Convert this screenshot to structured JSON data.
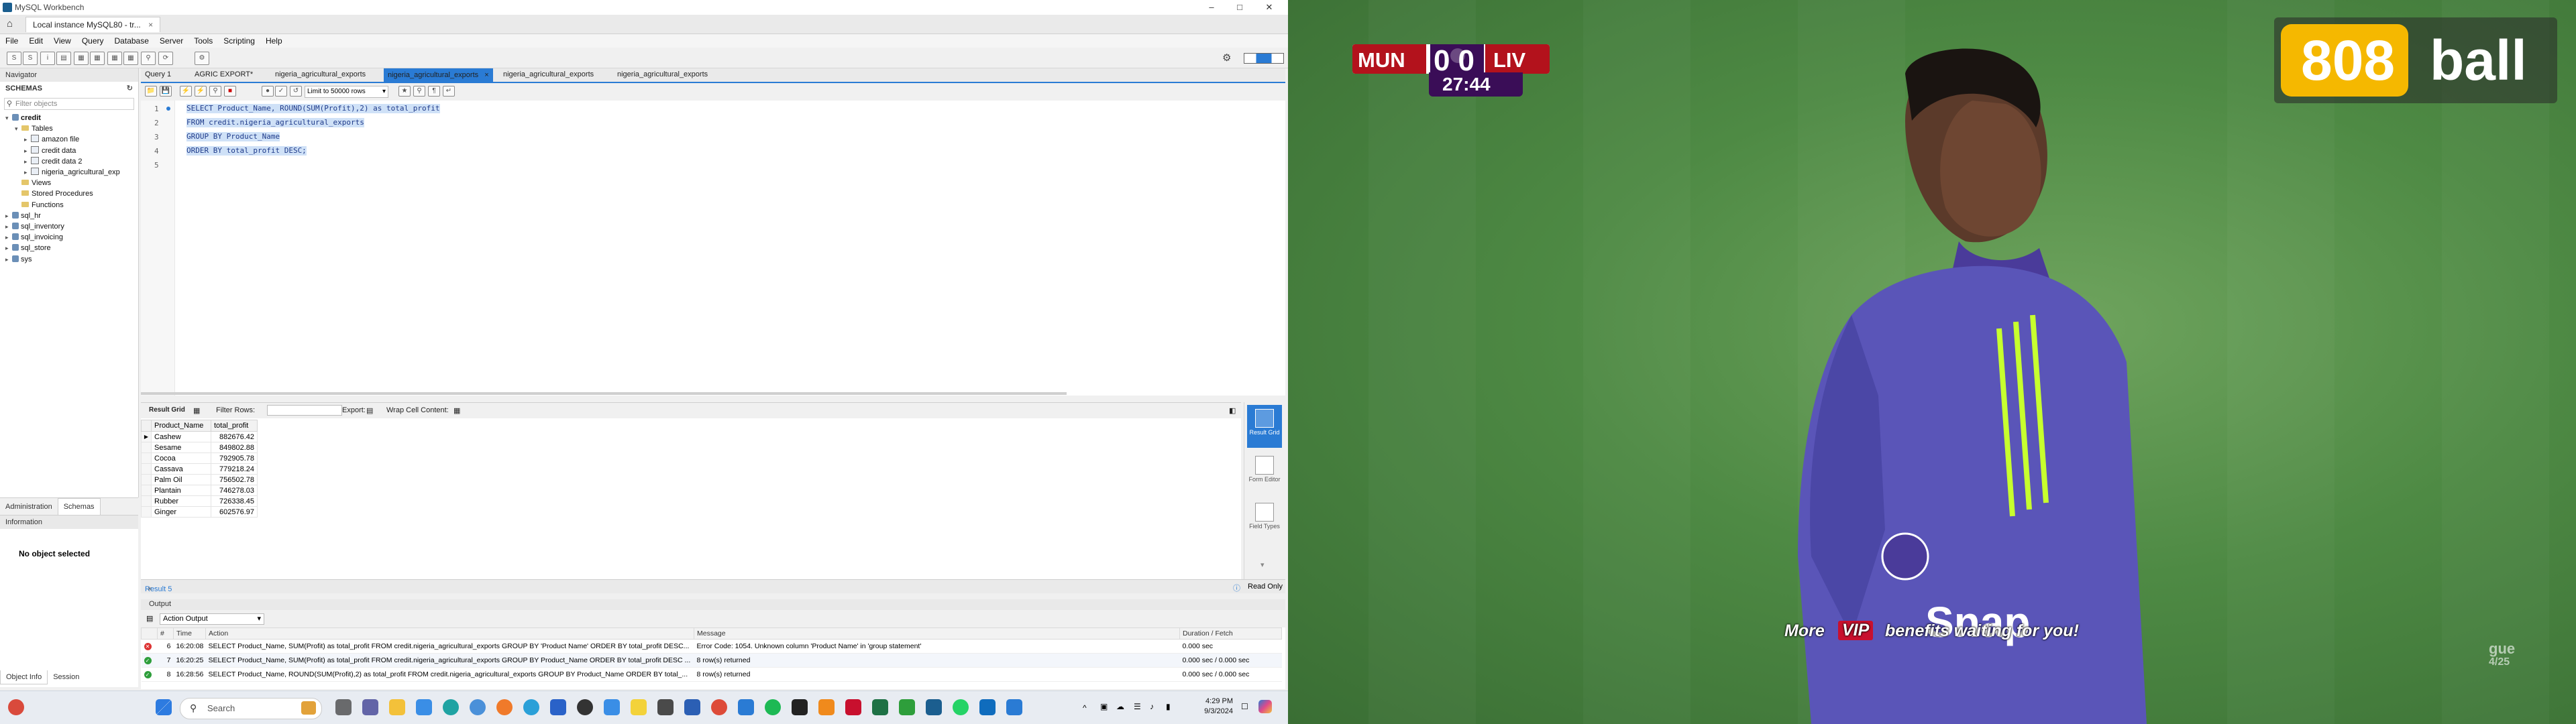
{
  "app": {
    "window_title": "MySQL Workbench",
    "connection_tab": "Local instance MySQL80 - tr...",
    "menu": [
      "File",
      "Edit",
      "View",
      "Query",
      "Database",
      "Server",
      "Tools",
      "Scripting",
      "Help"
    ]
  },
  "navigator": {
    "header": "Navigator",
    "schemas_label": "SCHEMAS",
    "filter_placeholder": "Filter objects",
    "tree": [
      {
        "label": "credit",
        "level": 0,
        "type": "db",
        "expanded": true,
        "bold": true
      },
      {
        "label": "Tables",
        "level": 1,
        "type": "folder",
        "expanded": true
      },
      {
        "label": "amazon file",
        "level": 2,
        "type": "table"
      },
      {
        "label": "credit data",
        "level": 2,
        "type": "table"
      },
      {
        "label": "credit data 2",
        "level": 2,
        "type": "table"
      },
      {
        "label": "nigeria_agricultural_exp",
        "level": 2,
        "type": "table"
      },
      {
        "label": "Views",
        "level": 1,
        "type": "folder"
      },
      {
        "label": "Stored Procedures",
        "level": 1,
        "type": "folder"
      },
      {
        "label": "Functions",
        "level": 1,
        "type": "folder"
      },
      {
        "label": "sql_hr",
        "level": 0,
        "type": "db"
      },
      {
        "label": "sql_inventory",
        "level": 0,
        "type": "db"
      },
      {
        "label": "sql_invoicing",
        "level": 0,
        "type": "db"
      },
      {
        "label": "sql_store",
        "level": 0,
        "type": "db"
      },
      {
        "label": "sys",
        "level": 0,
        "type": "db"
      }
    ],
    "tabs": [
      "Administration",
      "Schemas"
    ],
    "info_header": "Information",
    "no_object": "No object selected",
    "info_tabs": [
      "Object Info",
      "Session"
    ]
  },
  "editor": {
    "tabs": [
      {
        "label": "Query 1",
        "active": false
      },
      {
        "label": "AGRIC EXPORT*",
        "active": false
      },
      {
        "label": "nigeria_agricultural_exports",
        "active": false
      },
      {
        "label": "nigeria_agricultural_exports",
        "active": true
      },
      {
        "label": "nigeria_agricultural_exports",
        "active": false
      },
      {
        "label": "nigeria_agricultural_exports",
        "active": false
      }
    ],
    "limit_select": "Limit to 50000 rows",
    "lines": [
      {
        "num": "1",
        "text": "SELECT Product_Name, ROUND(SUM(Profit),2) as total_profit"
      },
      {
        "num": "2",
        "text": "FROM credit.nigeria_agricultural_exports"
      },
      {
        "num": "3",
        "text": "GROUP BY Product_Name"
      },
      {
        "num": "4",
        "text": "ORDER BY total_profit DESC;"
      },
      {
        "num": "5",
        "text": ""
      }
    ]
  },
  "results": {
    "toolbar": {
      "result_grid": "Result Grid",
      "filter_rows": "Filter Rows:",
      "export": "Export:",
      "wrap": "Wrap Cell Content:"
    },
    "columns": [
      "Product_Name",
      "total_profit"
    ],
    "rows": [
      [
        "Cashew",
        "882676.42"
      ],
      [
        "Sesame",
        "849802.88"
      ],
      [
        "Cocoa",
        "792905.78"
      ],
      [
        "Cassava",
        "779218.24"
      ],
      [
        "Palm Oil",
        "756502.78"
      ],
      [
        "Plantain",
        "746278.03"
      ],
      [
        "Rubber",
        "726338.45"
      ],
      [
        "Ginger",
        "602576.97"
      ]
    ],
    "side_buttons": [
      {
        "label": "Result Grid",
        "active": true
      },
      {
        "label": "Form Editor",
        "active": false
      },
      {
        "label": "Field Types",
        "active": false
      }
    ],
    "result_tab": "Result 5",
    "read_only": "Read Only"
  },
  "output": {
    "header": "Output",
    "selector": "Action Output",
    "columns": [
      "#",
      "Time",
      "Action",
      "Message",
      "Duration / Fetch"
    ],
    "rows": [
      {
        "status": "error",
        "num": "6",
        "time": "16:20:08",
        "action": "SELECT Product_Name, SUM(Profit) as total_profit FROM credit.nigeria_agricultural_exports GROUP BY 'Product Name' ORDER BY total_profit DESC...",
        "message": "Error Code: 1054. Unknown column 'Product Name' in 'group statement'",
        "duration": "0.000 sec"
      },
      {
        "status": "ok",
        "num": "7",
        "time": "16:20:25",
        "action": "SELECT Product_Name, SUM(Profit) as total_profit FROM credit.nigeria_agricultural_exports GROUP BY Product_Name ORDER BY total_profit DESC ...",
        "message": "8 row(s) returned",
        "duration": "0.000 sec / 0.000 sec"
      },
      {
        "status": "ok",
        "num": "8",
        "time": "16:28:56",
        "action": "SELECT Product_Name, ROUND(SUM(Profit),2) as total_profit FROM credit.nigeria_agricultural_exports GROUP BY Product_Name ORDER BY total_...",
        "message": "8 row(s) returned",
        "duration": "0.000 sec / 0.000 sec"
      }
    ]
  },
  "taskbar": {
    "search_label": "Search",
    "time": "4:29 PM",
    "date": "9/3/2024"
  },
  "video": {
    "home_team": "MUN",
    "away_team": "LIV",
    "score": "0-0",
    "home_score": "0",
    "away_score": "0",
    "match_clock": "27:44",
    "brand_number": "808",
    "brand_word": "ball",
    "caption_pre": "More",
    "caption_vip": "VIP",
    "caption_post": "benefits waiting for you!",
    "kit_text": "Snap",
    "league_text": "gue",
    "league_year": "4/25",
    "colors": {
      "team_red": "#b3121c",
      "score_purple": "#3a0d57",
      "pitch_green": "#4e8a44",
      "kit_purple": "#5a55b8"
    }
  }
}
